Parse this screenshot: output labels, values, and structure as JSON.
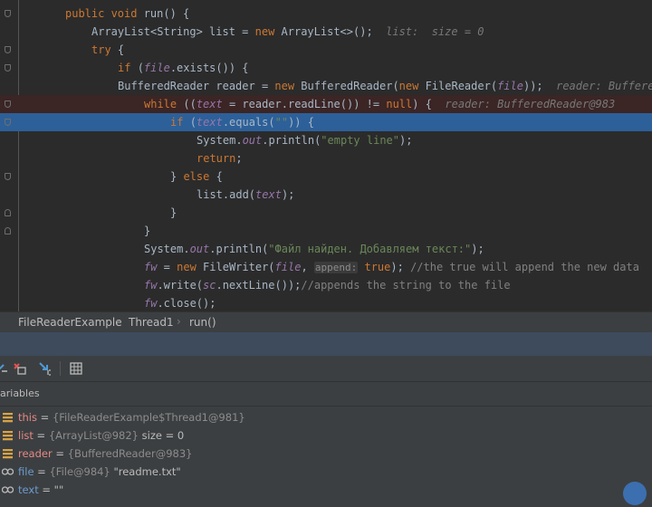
{
  "code_lines": [
    {
      "indent": "",
      "fold": "open",
      "parts": [
        {
          "c": "kw",
          "t": "public void "
        },
        {
          "c": "",
          "t": "run() {"
        }
      ]
    },
    {
      "indent": "    ",
      "fold": "",
      "parts": [
        {
          "c": "",
          "t": "ArrayList<String> list = "
        },
        {
          "c": "kw",
          "t": "new "
        },
        {
          "c": "",
          "t": "ArrayList<>();"
        },
        {
          "c": "hint",
          "t": "  list:  size = 0"
        }
      ]
    },
    {
      "indent": "    ",
      "fold": "open",
      "parts": [
        {
          "c": "kw",
          "t": "try "
        },
        {
          "c": "",
          "t": "{"
        }
      ]
    },
    {
      "indent": "        ",
      "fold": "open",
      "parts": [
        {
          "c": "kw",
          "t": "if "
        },
        {
          "c": "",
          "t": "("
        },
        {
          "c": "itp",
          "t": "file"
        },
        {
          "c": "",
          "t": ".exists()) {"
        }
      ]
    },
    {
      "indent": "        ",
      "fold": "",
      "parts": [
        {
          "c": "",
          "t": "BufferedReader reader = "
        },
        {
          "c": "kw",
          "t": "new "
        },
        {
          "c": "",
          "t": "BufferedReader("
        },
        {
          "c": "kw",
          "t": "new "
        },
        {
          "c": "",
          "t": "FileReader("
        },
        {
          "c": "itp",
          "t": "file"
        },
        {
          "c": "",
          "t": "));"
        },
        {
          "c": "hint",
          "t": "  reader: BufferedRe"
        }
      ]
    },
    {
      "indent": "            ",
      "fold": "open",
      "bg": "bp",
      "parts": [
        {
          "c": "kw",
          "t": "while "
        },
        {
          "c": "",
          "t": "(("
        },
        {
          "c": "it",
          "t": "text"
        },
        {
          "c": "",
          "t": " = reader.readLine()) != "
        },
        {
          "c": "kw",
          "t": "null"
        },
        {
          "c": "",
          "t": ") {"
        },
        {
          "c": "hint",
          "t": "  reader: BufferedReader@983"
        }
      ]
    },
    {
      "indent": "                ",
      "fold": "open",
      "bg": "exec",
      "parts": [
        {
          "c": "kw",
          "t": "if "
        },
        {
          "c": "",
          "t": "("
        },
        {
          "c": "it",
          "t": "text"
        },
        {
          "c": "",
          "t": ".equals("
        },
        {
          "c": "str",
          "t": "\"\""
        },
        {
          "c": "",
          "t": ")) {"
        }
      ]
    },
    {
      "indent": "                    ",
      "fold": "",
      "parts": [
        {
          "c": "",
          "t": "System."
        },
        {
          "c": "it",
          "t": "out"
        },
        {
          "c": "",
          "t": ".println("
        },
        {
          "c": "str",
          "t": "\"empty line\""
        },
        {
          "c": "",
          "t": ");"
        }
      ]
    },
    {
      "indent": "                    ",
      "fold": "",
      "parts": [
        {
          "c": "kw",
          "t": "return"
        },
        {
          "c": "",
          "t": ";"
        }
      ]
    },
    {
      "indent": "                ",
      "fold": "open",
      "parts": [
        {
          "c": "",
          "t": "} "
        },
        {
          "c": "kw",
          "t": "else "
        },
        {
          "c": "",
          "t": "{"
        }
      ]
    },
    {
      "indent": "                    ",
      "fold": "",
      "parts": [
        {
          "c": "",
          "t": "list.add("
        },
        {
          "c": "it",
          "t": "text"
        },
        {
          "c": "",
          "t": ");"
        }
      ]
    },
    {
      "indent": "                ",
      "fold": "close",
      "parts": [
        {
          "c": "",
          "t": "}"
        }
      ]
    },
    {
      "indent": "            ",
      "fold": "close",
      "parts": [
        {
          "c": "",
          "t": "}"
        }
      ]
    },
    {
      "indent": "            ",
      "fold": "",
      "parts": [
        {
          "c": "",
          "t": "System."
        },
        {
          "c": "it",
          "t": "out"
        },
        {
          "c": "",
          "t": ".println("
        },
        {
          "c": "str",
          "t": "\"Файл найден. Добавляем текст:\""
        },
        {
          "c": "",
          "t": ");"
        }
      ]
    },
    {
      "indent": "            ",
      "fold": "",
      "parts": [
        {
          "c": "itp",
          "t": "fw"
        },
        {
          "c": "",
          "t": " = "
        },
        {
          "c": "kw",
          "t": "new "
        },
        {
          "c": "",
          "t": "FileWriter("
        },
        {
          "c": "itp",
          "t": "file"
        },
        {
          "c": "",
          "t": ", "
        },
        {
          "c": "phint",
          "t": "append:"
        },
        {
          "c": "",
          "t": " "
        },
        {
          "c": "kw",
          "t": "true"
        },
        {
          "c": "",
          "t": "); "
        },
        {
          "c": "cmt",
          "t": "//the true will append the new data"
        }
      ]
    },
    {
      "indent": "            ",
      "fold": "",
      "parts": [
        {
          "c": "itp",
          "t": "fw"
        },
        {
          "c": "",
          "t": ".write("
        },
        {
          "c": "itp",
          "t": "sc"
        },
        {
          "c": "",
          "t": ".nextLine());"
        },
        {
          "c": "cmt",
          "t": "//appends the string to the file"
        }
      ]
    },
    {
      "indent": "            ",
      "fold": "",
      "parts": [
        {
          "c": "itp",
          "t": "fw"
        },
        {
          "c": "",
          "t": ".close();"
        }
      ]
    }
  ],
  "breadcrumb": [
    "FileReaderExample",
    "Thread1",
    "run()"
  ],
  "variables_title": "ariables",
  "variables": [
    {
      "icon": "field-icon",
      "name": "this",
      "type": "{FileReaderExample$Thread1@981}",
      "extra": ""
    },
    {
      "icon": "field-icon",
      "name": "list",
      "type": "{ArrayList@982}",
      "extra": " size = 0"
    },
    {
      "icon": "field-icon",
      "name": "reader",
      "type": "{BufferedReader@983}",
      "extra": ""
    },
    {
      "icon": "watch-icon",
      "name": "file",
      "type": "{File@984}",
      "extra": " \"readme.txt\""
    },
    {
      "icon": "watch-icon",
      "name": "text",
      "type": "",
      "extra": "\"\""
    }
  ],
  "colors": {
    "keyword": "#cc7832",
    "string": "#6a8759",
    "execution_line": "#2d6099",
    "breakpoint_line": "#3b2525"
  }
}
